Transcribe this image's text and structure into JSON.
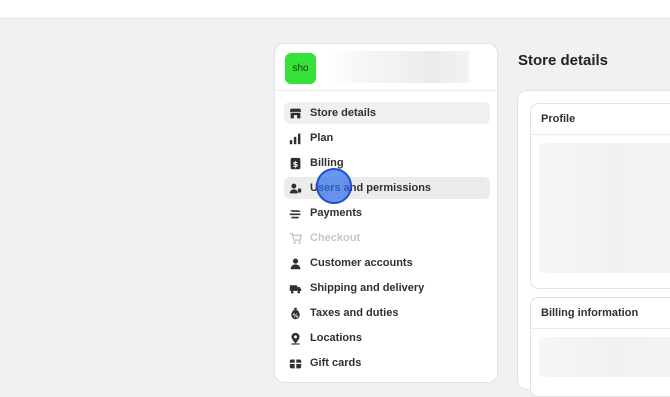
{
  "store": {
    "avatar_text": "sho"
  },
  "page": {
    "title": "Store details"
  },
  "sidebar": {
    "items": [
      {
        "label": "Store details",
        "icon": "store-icon",
        "state": "active"
      },
      {
        "label": "Plan",
        "icon": "plan-icon",
        "state": "normal"
      },
      {
        "label": "Billing",
        "icon": "billing-icon",
        "state": "normal"
      },
      {
        "label": "Users and permissions",
        "icon": "users-icon",
        "state": "hover"
      },
      {
        "label": "Payments",
        "icon": "payments-icon",
        "state": "normal"
      },
      {
        "label": "Checkout",
        "icon": "cart-icon",
        "state": "disabled"
      },
      {
        "label": "Customer accounts",
        "icon": "person-icon",
        "state": "normal"
      },
      {
        "label": "Shipping and delivery",
        "icon": "truck-icon",
        "state": "normal"
      },
      {
        "label": "Taxes and duties",
        "icon": "tax-icon",
        "state": "normal"
      },
      {
        "label": "Locations",
        "icon": "location-icon",
        "state": "normal"
      },
      {
        "label": "Gift cards",
        "icon": "gift-icon",
        "state": "normal"
      }
    ]
  },
  "sections": {
    "profile": {
      "title": "Profile"
    },
    "billing_info": {
      "title": "Billing information"
    }
  },
  "colors": {
    "avatar": "#36e23a",
    "cursor": "#2f6eeb",
    "background": "#f1f1f1"
  }
}
